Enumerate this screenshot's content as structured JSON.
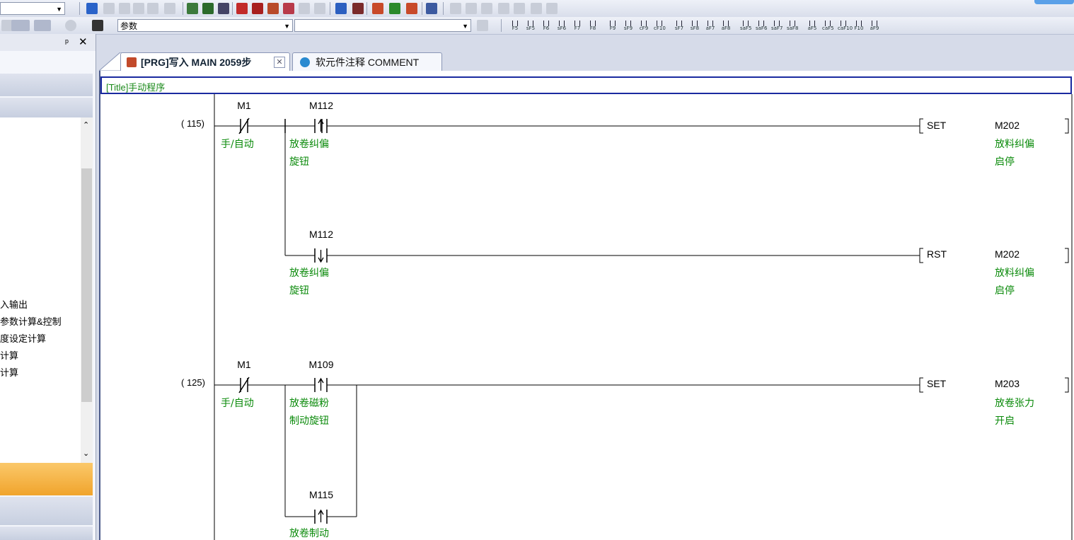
{
  "toolbar2": {
    "search_value": "参数",
    "fkeys": [
      "F5",
      "sF5",
      "F6",
      "sF6",
      "F7",
      "F8",
      "F9",
      "sF9",
      "cF9",
      "cF10",
      "sF7",
      "sF8",
      "aF7",
      "aF8",
      "saF5",
      "saF6",
      "saF7",
      "saF8",
      "aF5",
      "caF5",
      "caF10",
      "F10",
      "aF9"
    ]
  },
  "nav": {
    "items": [
      "入输出",
      "参数计算&控制",
      "度设定计算",
      "计算",
      "计算"
    ]
  },
  "tabs": [
    {
      "label": "[PRG]写入 MAIN 2059步"
    },
    {
      "label": "软元件注释 COMMENT"
    }
  ],
  "ladder": {
    "title": "[Title]手动程序",
    "rungs": [
      {
        "step": "( 115)",
        "contacts": [
          {
            "device": "M1",
            "comment": [
              "手/自动"
            ]
          },
          {
            "device": "M112",
            "comment": [
              "放卷纠偏",
              "旋钮"
            ]
          },
          {
            "device": "M112",
            "comment": [
              "放卷纠偏",
              "旋钮"
            ]
          }
        ],
        "outputs": [
          {
            "instr": "SET",
            "device": "M202",
            "comment": [
              "放料纠偏",
              "启停"
            ]
          },
          {
            "instr": "RST",
            "device": "M202",
            "comment": [
              "放料纠偏",
              "启停"
            ]
          }
        ]
      },
      {
        "step": "( 125)",
        "contacts": [
          {
            "device": "M1",
            "comment": [
              "手/自动"
            ]
          },
          {
            "device": "M109",
            "comment": [
              "放卷磁粉",
              "制动旋钮"
            ]
          },
          {
            "device": "M115",
            "comment": [
              "放卷制动"
            ]
          }
        ],
        "outputs": [
          {
            "instr": "SET",
            "device": "M203",
            "comment": [
              "放卷张力",
              "开启"
            ]
          }
        ]
      }
    ]
  }
}
